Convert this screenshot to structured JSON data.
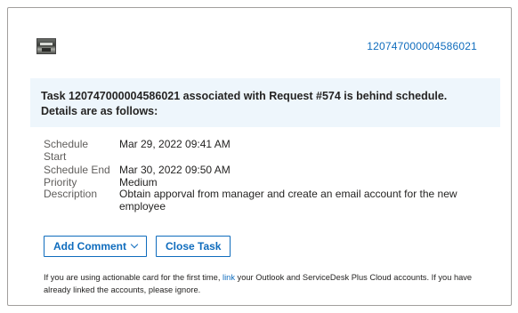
{
  "header": {
    "task_id_link": "120747000004586021"
  },
  "banner": {
    "line1": "Task 120747000004586021 associated with Request #574 is behind schedule.",
    "line2": "Details are as follows:"
  },
  "details": [
    {
      "label": "Schedule\nStart",
      "value": "Mar 29, 2022 09:41 AM"
    },
    {
      "label": "Schedule End",
      "value": "Mar 30, 2022 09:50 AM"
    },
    {
      "label": "Priority",
      "value": "Medium"
    },
    {
      "label": "Description",
      "value": "Obtain apporval from manager and create an email account for the new employee"
    }
  ],
  "actions": {
    "add_comment_label": "Add Comment",
    "close_task_label": "Close Task"
  },
  "footer": {
    "text_before": "If you are using actionable card for the first time, ",
    "link_label": "link",
    "text_after": " your Outlook and ServiceDesk Plus Cloud accounts. If you have already linked the accounts, please ignore."
  },
  "colors": {
    "accent": "#0f6cbd",
    "banner_bg": "#eef6fc",
    "border": "#a19f9d"
  }
}
